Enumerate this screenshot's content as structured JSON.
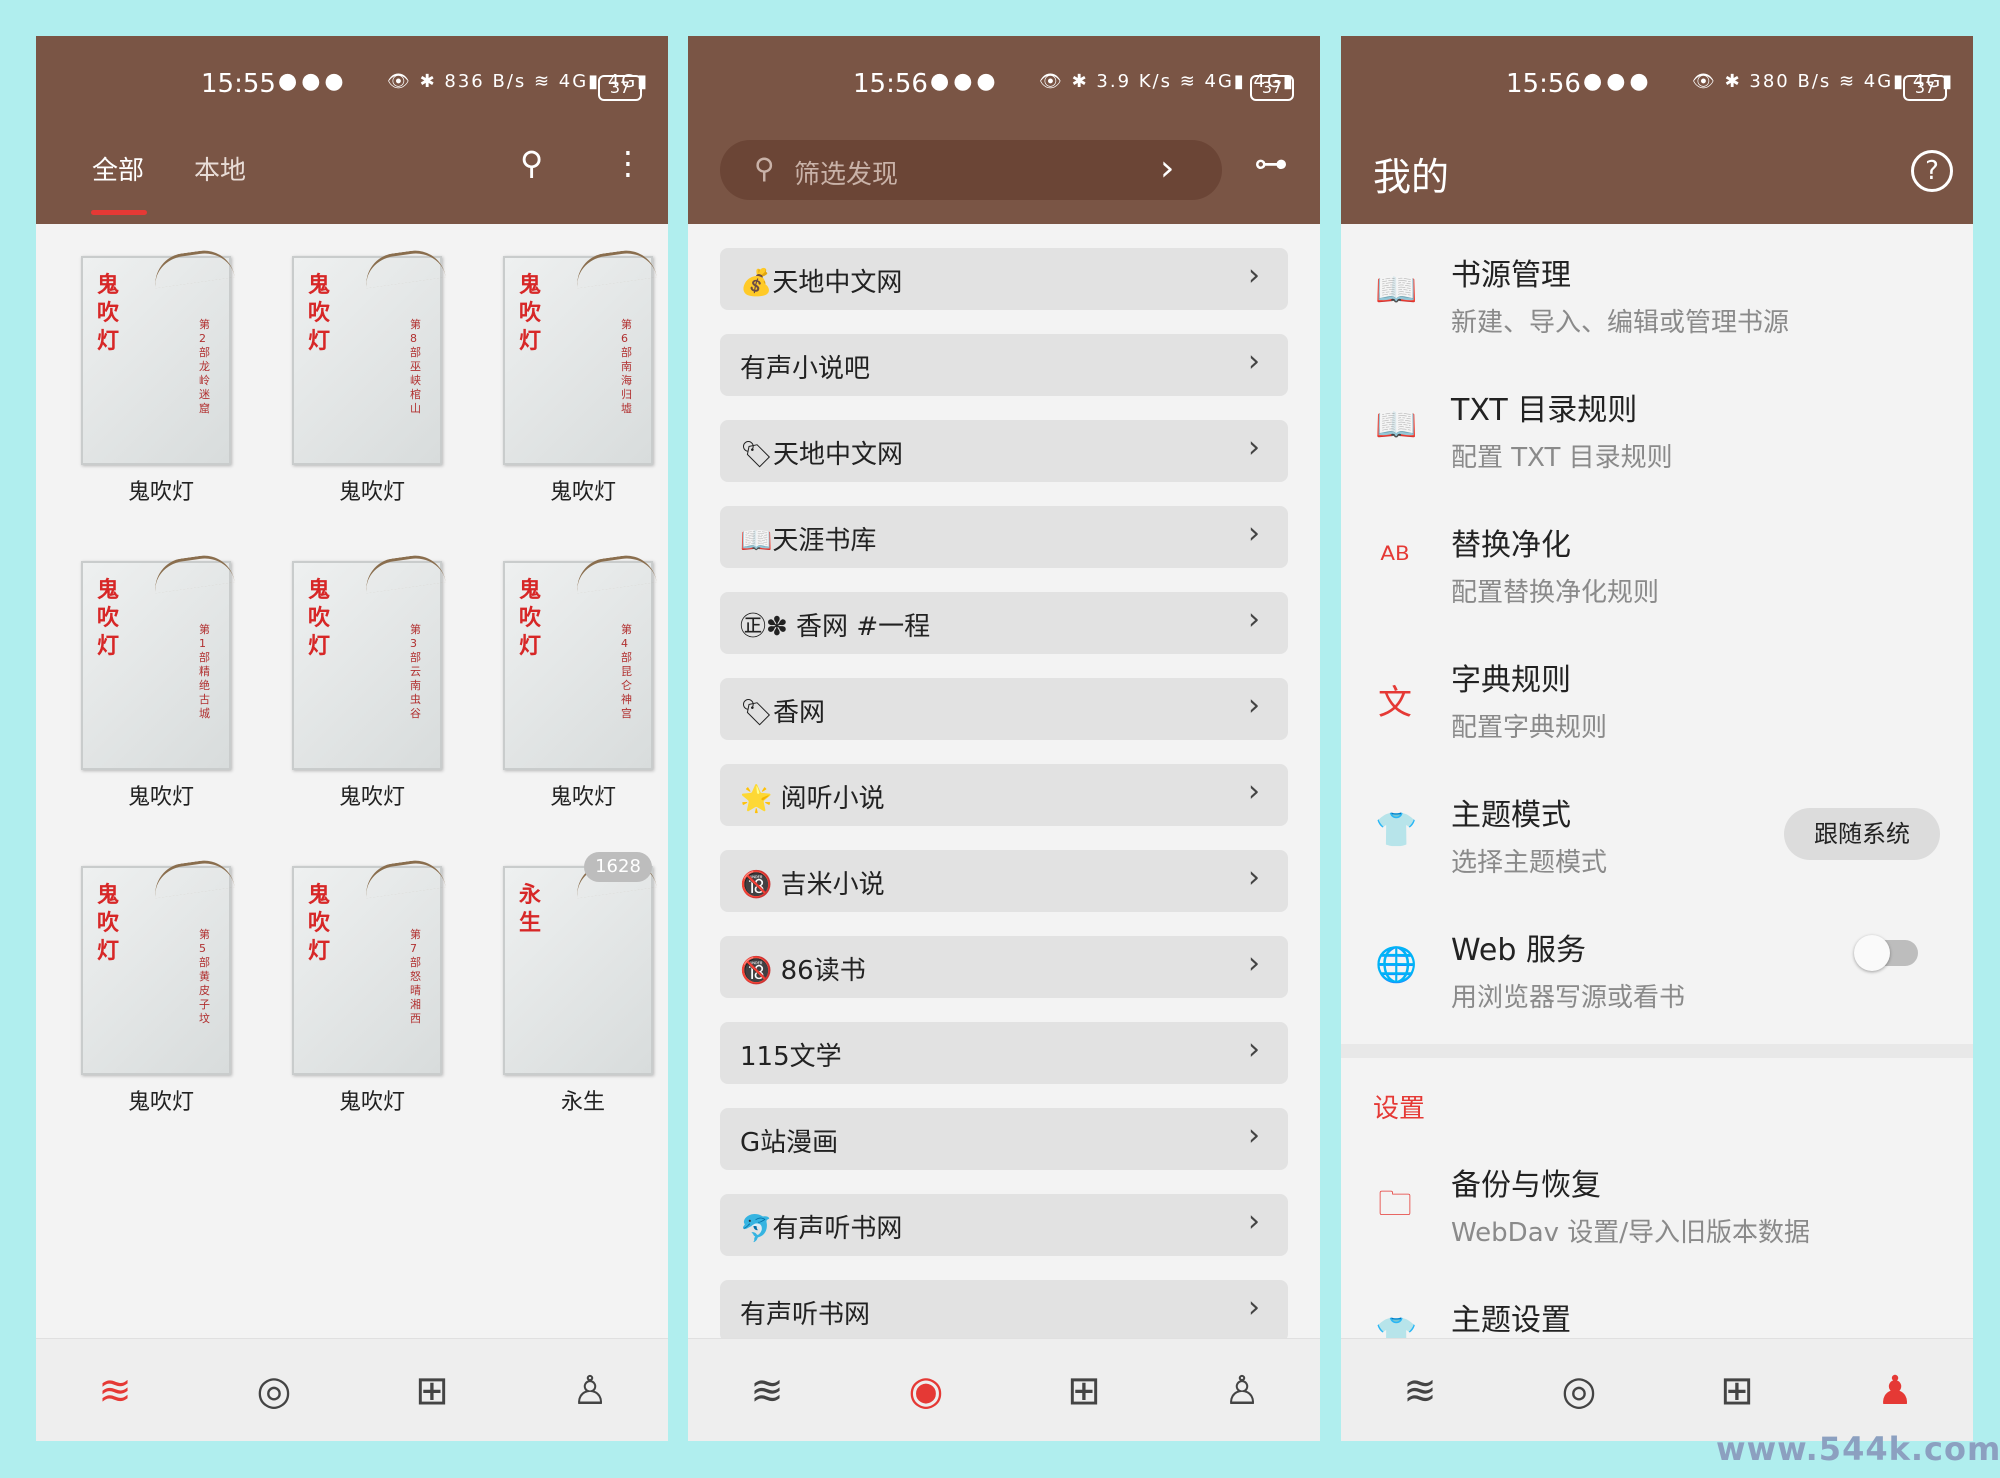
{
  "colors": {
    "header": "#7a5545",
    "accent": "#e53935",
    "background": "#b0eeee"
  },
  "phones": [
    {
      "status": {
        "time": "15:55",
        "speed": "836 B/s",
        "battery": "37"
      },
      "tabs": [
        "全部",
        "本地"
      ],
      "books": [
        {
          "title": "鬼吹灯",
          "cover_title": "鬼吹灯",
          "cover_sub": "第2部龙岭迷窟"
        },
        {
          "title": "鬼吹灯",
          "cover_title": "鬼吹灯",
          "cover_sub": "第8部巫峡棺山"
        },
        {
          "title": "鬼吹灯",
          "cover_title": "鬼吹灯",
          "cover_sub": "第6部南海归墟"
        },
        {
          "title": "鬼吹灯",
          "cover_title": "鬼吹灯",
          "cover_sub": "第1部精绝古城"
        },
        {
          "title": "鬼吹灯",
          "cover_title": "鬼吹灯",
          "cover_sub": "第3部云南虫谷"
        },
        {
          "title": "鬼吹灯",
          "cover_title": "鬼吹灯",
          "cover_sub": "第4部昆仑神宫"
        },
        {
          "title": "鬼吹灯",
          "cover_title": "鬼吹灯",
          "cover_sub": "第5部黄皮子坟"
        },
        {
          "title": "鬼吹灯",
          "cover_title": "鬼吹灯",
          "cover_sub": "第7部怒晴湘西"
        },
        {
          "title": "永生",
          "cover_title": "永生",
          "cover_sub": ""
        }
      ],
      "badge": "1628"
    },
    {
      "status": {
        "time": "15:56",
        "speed": "3.9 K/s",
        "battery": "37"
      },
      "search_placeholder": "筛选发现",
      "sources": [
        "💰天地中文网",
        "有声小说吧",
        "🏷天地中文网",
        "📖天涯书库",
        "㊣✽ 香网 #一程",
        "🏷香网",
        "🌟 阅听小说",
        "🔞 吉米小说",
        "🔞 86读书",
        "115文学",
        "G站漫画",
        "🐬有声听书网",
        "有声听书网"
      ]
    },
    {
      "status": {
        "time": "15:56",
        "speed": "380 B/s",
        "battery": "37"
      },
      "title": "我的",
      "rows": [
        {
          "title": "书源管理",
          "sub": "新建、导入、编辑或管理书源",
          "icon": "book-open-icon"
        },
        {
          "title": "TXT 目录规则",
          "sub": "配置 TXT 目录规则",
          "icon": "book-open-icon"
        },
        {
          "title": "替换净化",
          "sub": "配置替换净化规则",
          "icon": "replace-ab-icon"
        },
        {
          "title": "字典规则",
          "sub": "配置字典规则",
          "icon": "translate-icon"
        },
        {
          "title": "主题模式",
          "sub": "选择主题模式",
          "icon": "shirt-icon"
        },
        {
          "title": "Web 服务",
          "sub": "用浏览器写源或看书",
          "icon": "globe-icon"
        }
      ],
      "theme_mode_value": "跟随系统",
      "web_service_on": false,
      "section": "设置",
      "settings": [
        {
          "title": "备份与恢复",
          "sub": "WebDav 设置/导入旧版本数据",
          "icon": "folder-icon"
        },
        {
          "title": "主题设置",
          "sub": "",
          "icon": "shirt-icon"
        }
      ]
    }
  ],
  "watermark": "www.544k.com"
}
